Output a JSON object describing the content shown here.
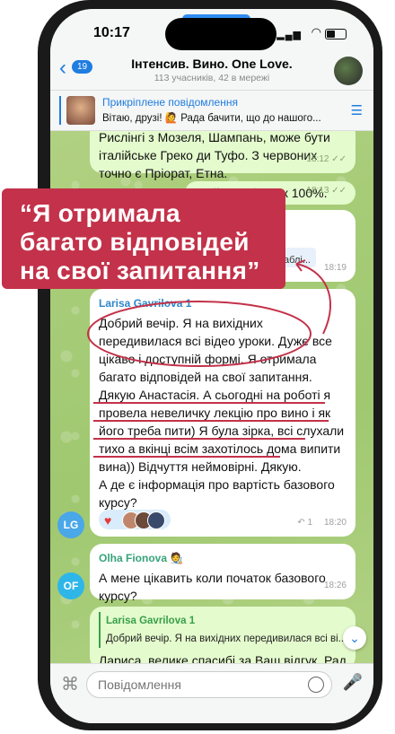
{
  "status": {
    "time": "10:17"
  },
  "header": {
    "back_count": "19",
    "title": "Інтенсив. Вино. One Love.",
    "subtitle": "113 учасників, 42 в мережі"
  },
  "pinned": {
    "title": "Прикріплене повідомлення",
    "text": "Вітаю, друзі! 🙋 Рада бачити, що до нашого..."
  },
  "messages": [
    {
      "text": "Рислінгі з Мозеля, Шампань, може бути італійське Греко ди Туфо. З червоних точно є Пріорат, Етна.",
      "time": "18:12"
    },
    {
      "text": "Ну й Менсія теж 100%.",
      "time": "18:13"
    },
    {
      "quote_hidden": "точно є Шаблі...",
      "time": "18:19"
    },
    {
      "sender": "Larisa Gavrilova 1",
      "text": "Добрий вечір. Я на вихідних передивилася всі відео уроки. Дуже все цікаво і доступній формі. Я отримала багато відповідей на свої запитання. Дякую Анастасія. А сьогодні на роботі я провела невеличку лекцію про вино і як його треба пити) Я була зірка, всі слухали тихо а вкінці всім захотілось дома випити вина)) Відчуття неймовірні. Дякую.",
      "text2": "А де є інформація про вартість базового курсу?",
      "time": "18:20",
      "forward_count": "1",
      "avatar": "LG"
    },
    {
      "sender": "Olha Fionova",
      "text": "А мене цікавить коли початок базового курсу?",
      "time": "18:26",
      "avatar": "OF"
    },
    {
      "reply_to": "Larisa Gavrilova 1",
      "reply_text": "Добрий вечір. Я на вихідних передивилася всі ві...",
      "text": "Лариса, велике спасибі за Ваш відгук. Рада"
    }
  ],
  "callout": {
    "lines": [
      "“Я отримала",
      "багато відповідей",
      "на свої запитання”"
    ]
  },
  "input": {
    "placeholder": "Повідомлення"
  },
  "colors": {
    "accent": "#1f7de0",
    "callout": "#c3324a",
    "annotation": "#c3324a"
  }
}
